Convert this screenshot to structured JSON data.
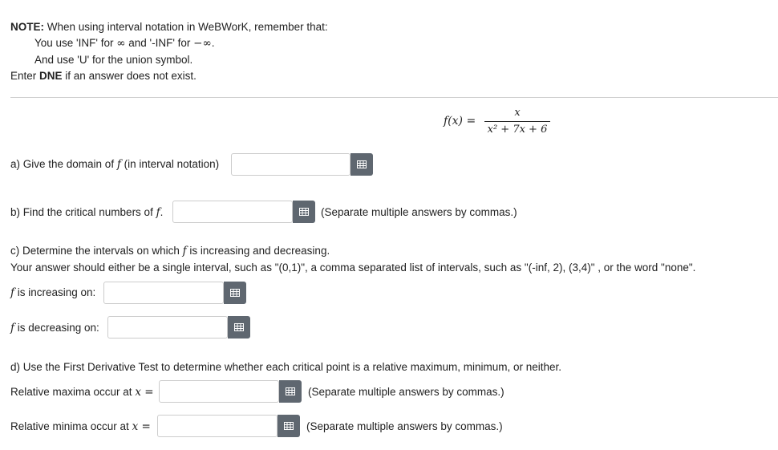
{
  "note": {
    "label": "NOTE:",
    "line1_rest": " When using interval notation in WeBWorK, remember that:",
    "line2_pre": "You use 'INF' for ",
    "inf_symbol": "∞",
    "line2_mid": " and '-INF' for ",
    "neg_inf_symbol": "−∞",
    "line2_end": ".",
    "line3": "And use 'U' for the union symbol.",
    "line4_pre": "Enter ",
    "line4_bold": "DNE",
    "line4_post": " if an answer does not exist."
  },
  "formula": {
    "lhs": "f(x) =",
    "numerator": "x",
    "denominator": "x² + 7x + 6"
  },
  "part_a": {
    "label_pre": "a) Give the domain of ",
    "f": "f",
    "label_post": " (in interval notation)",
    "value": ""
  },
  "part_b": {
    "label_pre": "b) Find the critical numbers of ",
    "f": "f",
    "label_post": ".",
    "hint": "(Separate multiple answers by commas.)",
    "value": ""
  },
  "part_c": {
    "line1_pre": "c) Determine the intervals on which ",
    "f": "f",
    "line1_post": " is increasing and decreasing.",
    "line2": "Your answer should either be a single interval, such as \"(0,1)\", a comma separated list of intervals, such as \"(-inf, 2), (3,4)\" , or the word \"none\".",
    "increasing_label": " is increasing on:",
    "decreasing_label": " is decreasing on:",
    "increasing_value": "",
    "decreasing_value": ""
  },
  "part_d": {
    "line1": "d) Use the First Derivative Test to determine whether each critical point is a relative maximum, minimum, or neither.",
    "maxima_label": "Relative maxima occur at ",
    "minima_label": "Relative minima occur at ",
    "x_eq": "x =",
    "hint": "(Separate multiple answers by commas.)",
    "maxima_value": "",
    "minima_value": ""
  },
  "icons": {
    "answer_button": "grid-icon"
  },
  "colors": {
    "button": "#5f6770",
    "separator": "#cfcfcf",
    "text": "#222222"
  }
}
